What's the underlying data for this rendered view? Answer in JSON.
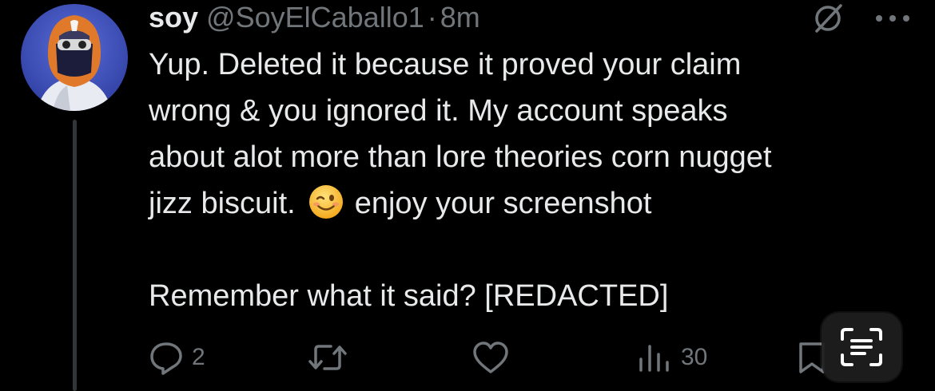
{
  "tweet": {
    "author_name": "soy",
    "handle": "@SoyElCaballo1",
    "separator": "·",
    "timestamp": "8m",
    "body_lines": [
      "Yup. Deleted it because it proved your claim",
      "wrong & you ignored it. My account speaks",
      "about alot more than lore theories corn nugget"
    ],
    "line4_before": "jizz biscuit.",
    "line4_emoji": "winking-face",
    "line4_after": "enjoy your screenshot",
    "last_line": "Remember what it said? [REDACTED]"
  },
  "actions": {
    "replies": "2",
    "retweets": "",
    "likes": "",
    "views": "30"
  },
  "icons": {
    "reply": "comment-icon",
    "retweet": "retweet-icon",
    "like": "heart-icon",
    "views": "bar-chart-icon",
    "bookmark": "bookmark-icon",
    "muted": "mute-slash-icon",
    "more": "more-dots-icon",
    "scan": "live-text-scan-icon"
  },
  "colors": {
    "background": "#000000",
    "text": "#e7e9ea",
    "secondary": "#71767b",
    "thread_line": "#333639"
  }
}
